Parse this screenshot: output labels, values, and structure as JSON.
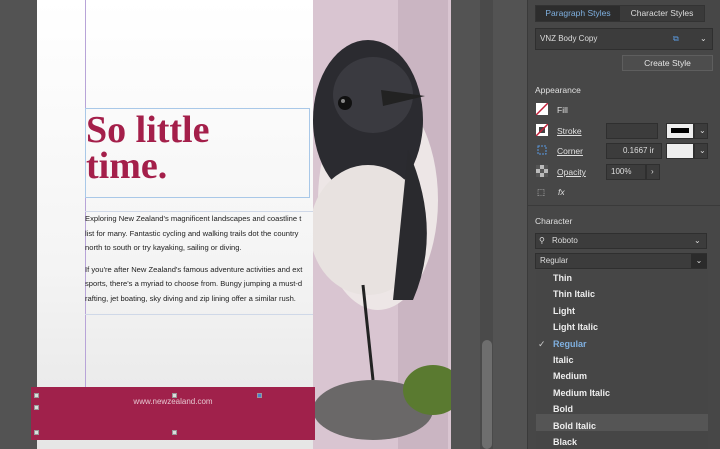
{
  "document": {
    "headline_line1": "So little",
    "headline_line2": "time.",
    "body_p1": [
      "Exploring New Zealand's magnificent landscapes and coastline t",
      "list for many. Fantastic cycling and walking trails dot the country",
      "north to south or try kayaking, sailing or diving."
    ],
    "body_p2": [
      "If you're after New Zealand's famous adventure activities and ext",
      "sports, there's a myriad to choose from. Bungy jumping a must-d",
      "rafting, jet boating, sky diving and zip lining offer a similar rush."
    ],
    "footer_url": "www.newzealand.com"
  },
  "panel": {
    "tabs": [
      "Paragraph Styles",
      "Character Styles"
    ],
    "active_tab": "Paragraph Styles",
    "style_select": "VNZ Body Copy",
    "create_style": "Create Style",
    "appearance": {
      "heading": "Appearance",
      "fill": "Fill",
      "stroke": "Stroke",
      "corner": "Corner",
      "corner_value": "0.1667 ir",
      "opacity": "Opacity",
      "opacity_value": "100%",
      "fx": "fx"
    },
    "character": {
      "heading": "Character",
      "font": "Roboto",
      "style": "Regular",
      "options": [
        "Thin",
        "Thin Italic",
        "Light",
        "Light Italic",
        "Regular",
        "Italic",
        "Medium",
        "Medium Italic",
        "Bold",
        "Bold Italic",
        "Black"
      ],
      "selected": "Regular",
      "hovered": "Bold Italic"
    },
    "colors": {
      "accent": "#7fb0e0",
      "brand": "#a0214b"
    }
  }
}
